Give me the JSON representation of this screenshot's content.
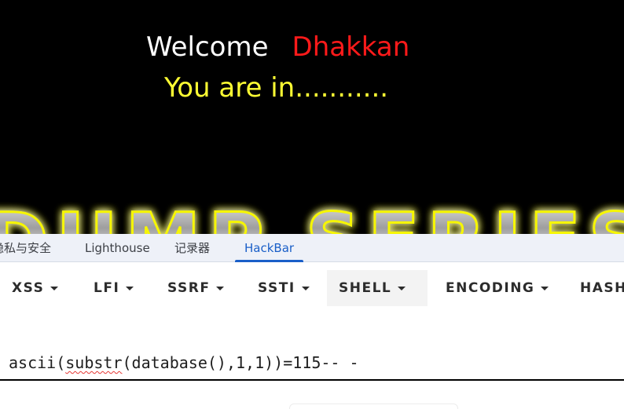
{
  "page": {
    "welcome_word": "Welcome",
    "user_name": "Dhakkan",
    "status_message": "You are in...........",
    "banner_text": "DUMP SERIES"
  },
  "devtools": {
    "tabs": [
      {
        "label": "隐私与安全",
        "active": false
      },
      {
        "label": "Lighthouse",
        "active": false
      },
      {
        "label": "记录器",
        "active": false
      },
      {
        "label": "HackBar",
        "active": true
      }
    ]
  },
  "hackbar": {
    "menus": [
      {
        "label": "XSS",
        "icon": "caret-down-icon"
      },
      {
        "label": "LFI",
        "icon": "caret-down-icon"
      },
      {
        "label": "SSRF",
        "icon": "caret-down-icon"
      },
      {
        "label": "SSTI",
        "icon": "caret-down-icon"
      },
      {
        "label": "SHELL",
        "icon": "caret-down-icon"
      },
      {
        "label": "ENCODING",
        "icon": "caret-down-icon"
      },
      {
        "label": "HASHING",
        "icon": "caret-down-icon"
      }
    ],
    "payload": {
      "before": "ascii(",
      "misspelled": "substr",
      "after": "(database(),1,1))=115-- -"
    }
  },
  "colors": {
    "page_background": "#000000",
    "welcome": "#ffffff",
    "user_name": "#ff1a1a",
    "status": "#ffff33",
    "banner_glow": "#f6f600",
    "active_tab": "#1a5fc8",
    "spellcheck": "#e53935"
  }
}
